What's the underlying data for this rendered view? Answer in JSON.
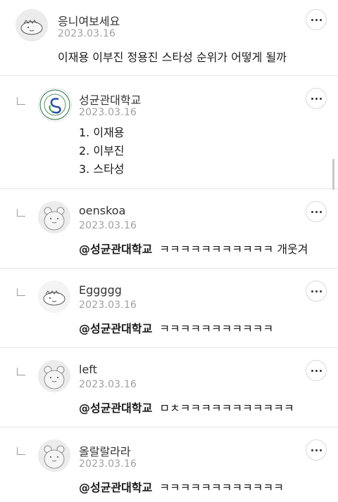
{
  "comments": [
    {
      "author": "응니여보세요",
      "date": "2023.03.16",
      "text": "이재용 이부진 정용진 스타성 순위가 어떻게 될까",
      "avatar_icon": "dinosaur-avatar-icon"
    },
    {
      "author": "성균관대학교",
      "date": "2023.03.16",
      "list": [
        "1. 이재용",
        "2. 이부진",
        "3. 스타성"
      ],
      "avatar_icon": "university-emblem-icon"
    },
    {
      "author": "oenskoa",
      "date": "2023.03.16",
      "mention": "@성균관대학교",
      "text": "ㅋㅋㅋㅋㅋㅋㅋㅋㅋㅋㅋ 개웃겨",
      "avatar_icon": "hamster-avatar-icon"
    },
    {
      "author": "Eggggg",
      "date": "2023.03.16",
      "mention": "@성균관대학교",
      "text": "ㅋㅋㅋㅋㅋㅋㅋㅋㅋㅋㅋ",
      "avatar_icon": "dinosaur-avatar-icon"
    },
    {
      "author": "left",
      "date": "2023.03.16",
      "mention": "@성균관대학교",
      "text": "ㅁㅊㅋㅋㅋㅋㅋㅋㅋㅋㅋㅋㅋ",
      "avatar_icon": "hamster-avatar-icon"
    },
    {
      "author": "올랄랄라라",
      "date": "2023.03.16",
      "mention": "@성균관대학교",
      "text": "ㅋㅋㅋㅋㅋㅋㅋㅋㅋㅋㅋㅋ",
      "avatar_icon": "hamster-avatar-icon"
    }
  ]
}
